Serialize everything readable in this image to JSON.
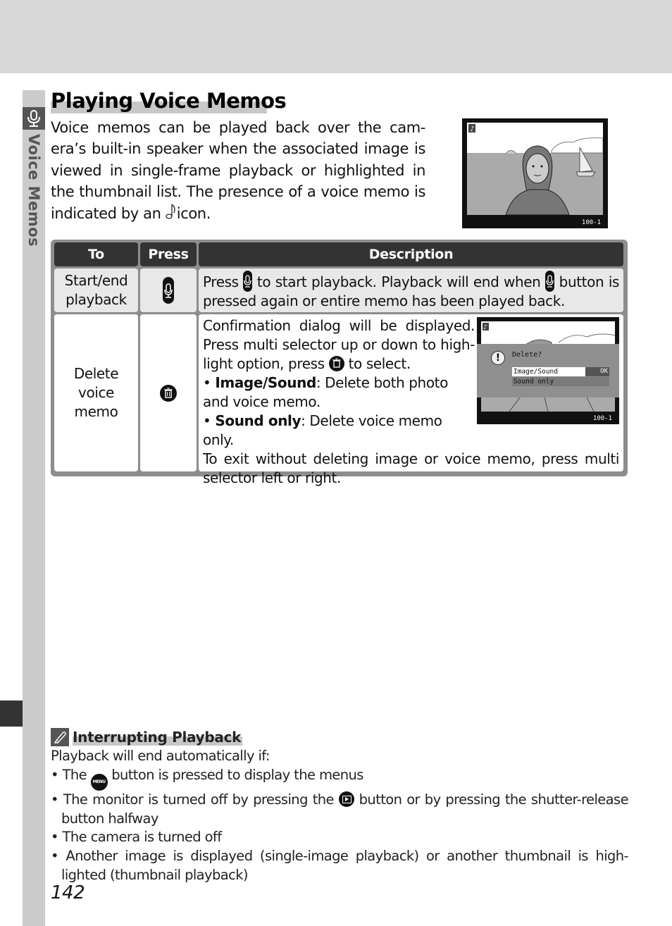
{
  "sidebar": {
    "section_label": "Voice Memos",
    "icon": "microphone-icon"
  },
  "page": {
    "title": "Playing Voice Memos",
    "intro_text": "Voice memos can be played back over the cam-era’s built-in speaker when the associated image is viewed in single-frame playback or highlighted in the thumbnail list.  The presence of a voice memo is indicated by an",
    "intro_icon": "voice-memo-note-icon",
    "intro_suffix": "icon.",
    "page_number": "142"
  },
  "playback_screen": {
    "counter": "100-1",
    "icon": "voice-memo-note-icon"
  },
  "table": {
    "headers": [
      "To",
      "Press",
      "Description"
    ],
    "rows": [
      {
        "to": "Start/end playback",
        "press_icon": "microphone-button-icon",
        "description_parts": [
          "Press",
          "to start playback.  Playback will end when",
          "button is pressed again or entire memo has been played back."
        ]
      },
      {
        "to": "Delete voice memo",
        "press_icon": "trash-button-icon",
        "description": {
          "line1": "Confirmation dialog will be displayed. Press multi selector up or down to high-light option, press",
          "line1_suffix": "to select.",
          "bullets": [
            {
              "bold": "Image/Sound",
              "text": ": Delete both photo and voice memo."
            },
            {
              "bold": "Sound only",
              "text": ": Delete voice memo only."
            }
          ],
          "closing": "To exit without deleting image or voice memo, press multi selector left or right."
        }
      }
    ]
  },
  "dialog_screen": {
    "prompt": "Delete?",
    "options": [
      "Image/Sound",
      "Sound only"
    ],
    "selected_option": "Image/Sound",
    "ok_label": "OK",
    "counter": "100-1"
  },
  "note": {
    "icon": "pencil-icon",
    "title": "Interrupting Playback",
    "intro": "Playback will end automatically if:",
    "items": [
      {
        "pre": "The",
        "icon": "menu-button-icon",
        "icon_label": "MENU",
        "post": "button is pressed to display the menus"
      },
      {
        "pre": "The monitor is turned off by pressing the",
        "icon": "playback-button-icon",
        "post": "button or by pressing the shutter-release button halfway"
      },
      {
        "text": "The camera is turned off"
      },
      {
        "text": "Another image is displayed (single-image playback) or another thumbnail is high-lighted (thumbnail playback)"
      }
    ]
  }
}
